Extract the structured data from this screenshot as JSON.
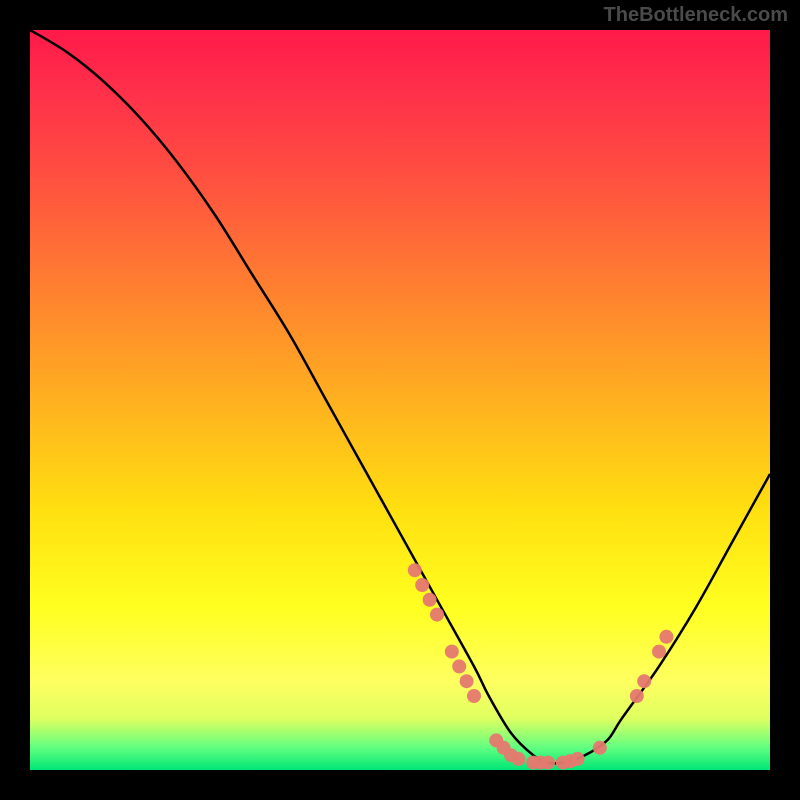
{
  "watermark": "TheBottleneck.com",
  "chart_data": {
    "type": "line",
    "title": "",
    "xlabel": "",
    "ylabel": "",
    "xlim": [
      0,
      100
    ],
    "ylim": [
      0,
      100
    ],
    "series": [
      {
        "name": "bottleneck-curve",
        "x": [
          0,
          5,
          10,
          15,
          20,
          25,
          30,
          35,
          40,
          45,
          50,
          55,
          60,
          62,
          65,
          68,
          70,
          72,
          75,
          78,
          80,
          85,
          90,
          95,
          100
        ],
        "y": [
          100,
          97,
          93,
          88,
          82,
          75,
          67,
          59,
          50,
          41,
          32,
          23,
          14,
          10,
          5,
          2,
          1,
          1,
          2,
          4,
          7,
          14,
          22,
          31,
          40
        ]
      }
    ],
    "highlight_points": [
      {
        "x": 52,
        "y": 27
      },
      {
        "x": 53,
        "y": 25
      },
      {
        "x": 54,
        "y": 23
      },
      {
        "x": 55,
        "y": 21
      },
      {
        "x": 57,
        "y": 16
      },
      {
        "x": 58,
        "y": 14
      },
      {
        "x": 59,
        "y": 12
      },
      {
        "x": 60,
        "y": 10
      },
      {
        "x": 63,
        "y": 4
      },
      {
        "x": 64,
        "y": 3
      },
      {
        "x": 65,
        "y": 2
      },
      {
        "x": 66,
        "y": 1.5
      },
      {
        "x": 68,
        "y": 1
      },
      {
        "x": 69,
        "y": 1
      },
      {
        "x": 70,
        "y": 1
      },
      {
        "x": 72,
        "y": 1
      },
      {
        "x": 73,
        "y": 1.2
      },
      {
        "x": 74,
        "y": 1.5
      },
      {
        "x": 77,
        "y": 3
      },
      {
        "x": 82,
        "y": 10
      },
      {
        "x": 83,
        "y": 12
      },
      {
        "x": 85,
        "y": 16
      },
      {
        "x": 86,
        "y": 18
      }
    ]
  }
}
